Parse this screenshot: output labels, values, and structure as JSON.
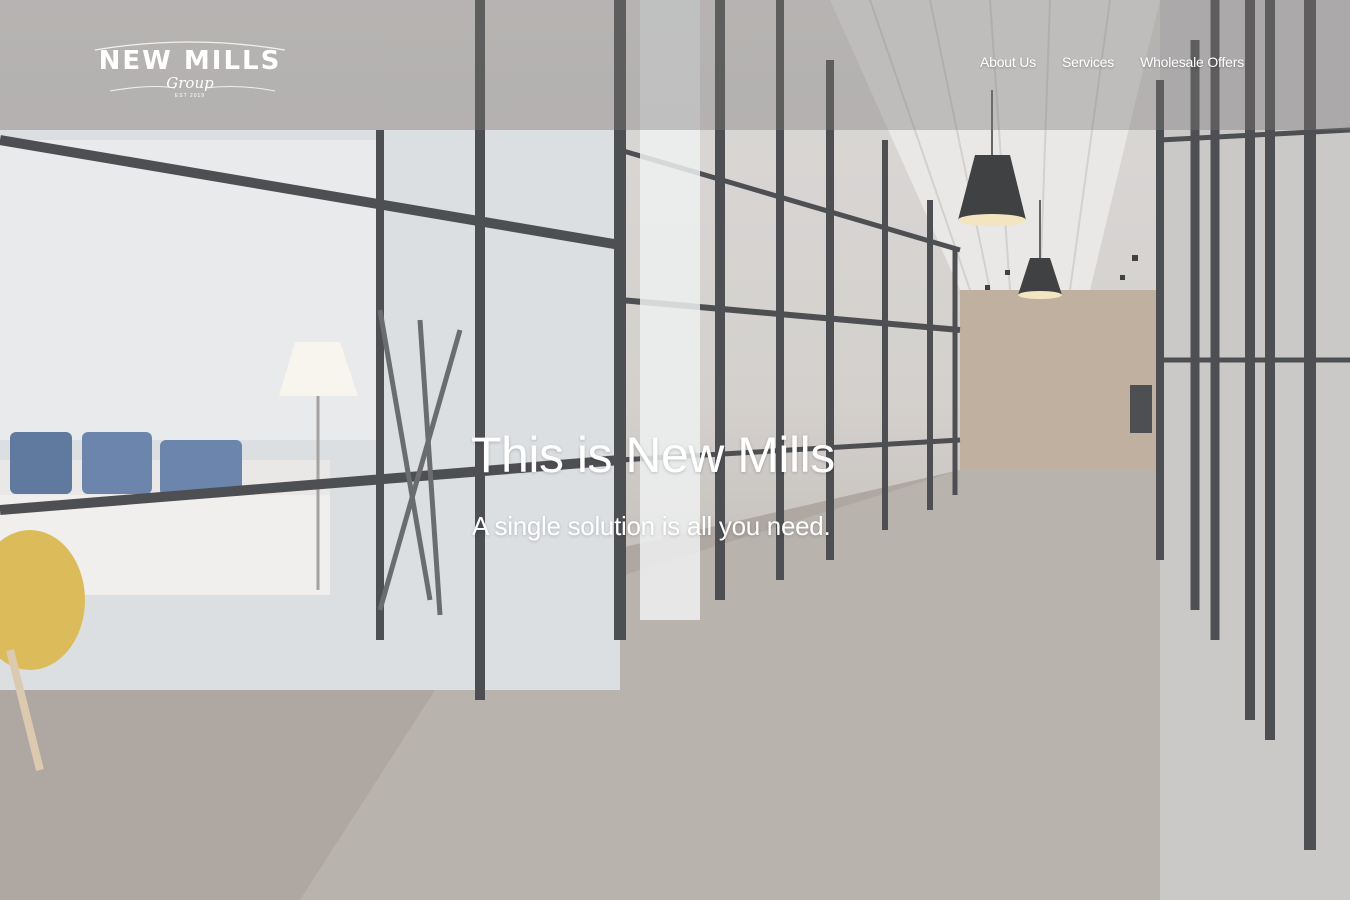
{
  "brand": {
    "name": "NEW MILLS",
    "sub": "Group",
    "est": "EST 2019"
  },
  "nav": {
    "items": [
      {
        "label": "About Us"
      },
      {
        "label": "Services"
      },
      {
        "label": "Wholesale Offers"
      }
    ]
  },
  "hero": {
    "title": "This is New Mills",
    "subtitle": "A single solution is all you need."
  }
}
